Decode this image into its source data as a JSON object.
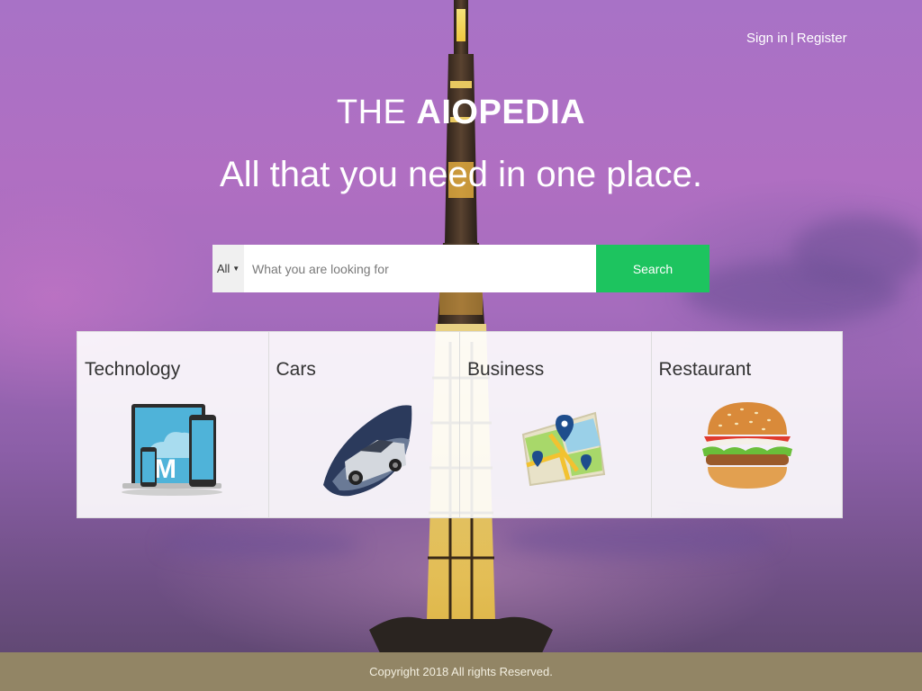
{
  "header": {
    "sign_in": "Sign in",
    "separator": "|",
    "register": "Register"
  },
  "hero": {
    "brand_prefix": "THE ",
    "brand_name": "AIOPEDIA",
    "tagline": "All that you need in one place."
  },
  "search": {
    "category": "All",
    "placeholder": "What you are looking for",
    "value": "",
    "button_label": "Search"
  },
  "categories": [
    {
      "label": "Technology",
      "icon": "devices-icon"
    },
    {
      "label": "Cars",
      "icon": "car-icon"
    },
    {
      "label": "Business",
      "icon": "map-icon"
    },
    {
      "label": "Restaurant",
      "icon": "burger-icon"
    }
  ],
  "footer": {
    "copyright": "Copyright 2018 All rights Reserved."
  },
  "colors": {
    "search_button": "#1dc45f",
    "footer_bg": "#928565"
  }
}
